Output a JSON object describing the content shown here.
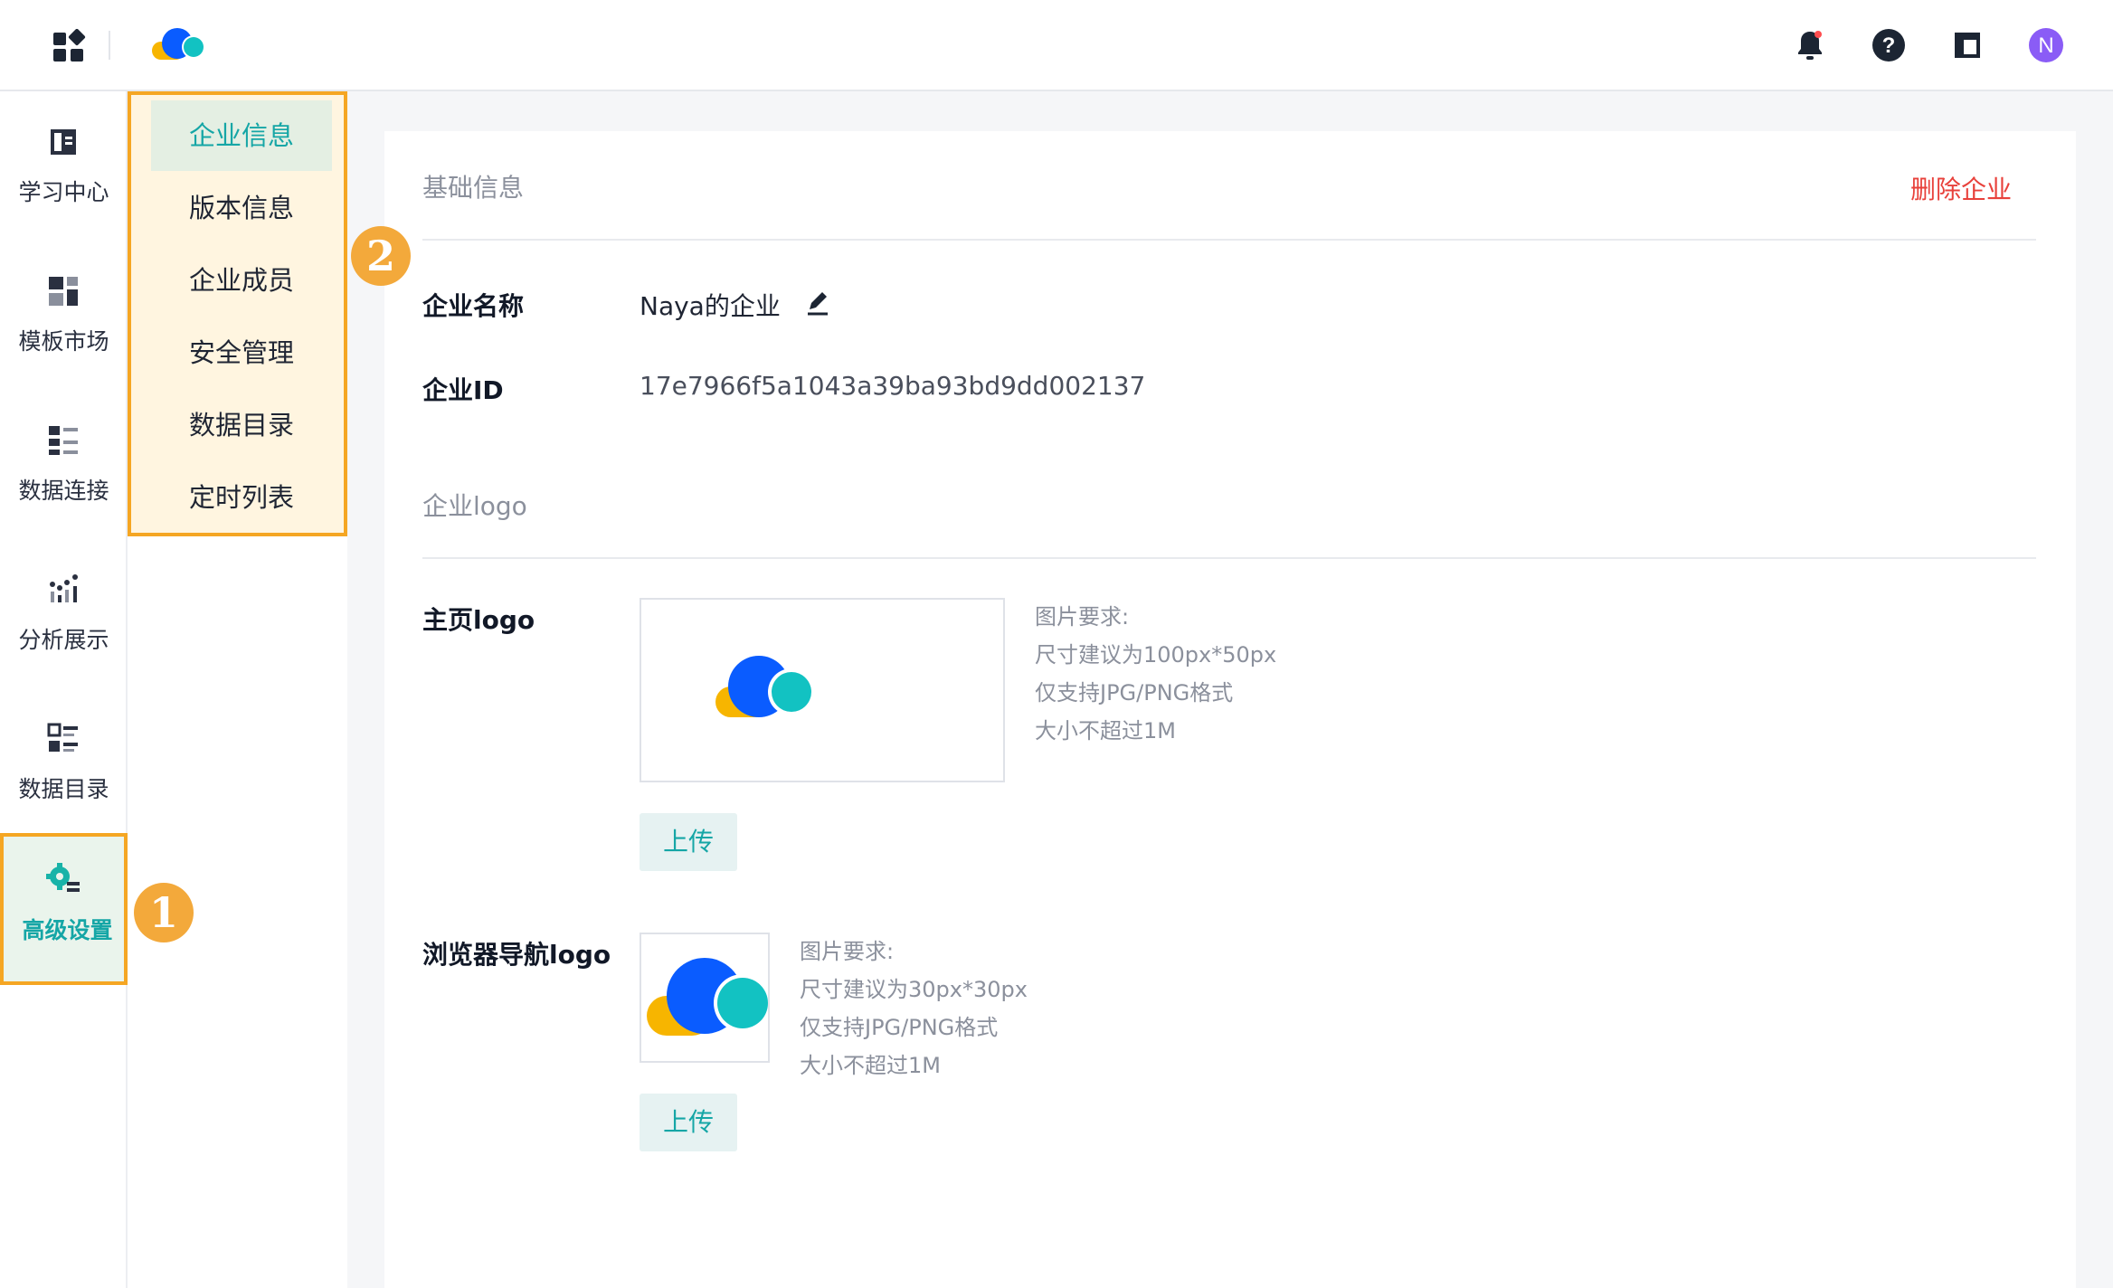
{
  "header": {
    "avatar_letter": "N",
    "accent": "#8a5cf6"
  },
  "rail": {
    "items": [
      {
        "label": "学习中心",
        "icon": "book-icon"
      },
      {
        "label": "模板市场",
        "icon": "template-icon"
      },
      {
        "label": "数据连接",
        "icon": "connection-icon"
      },
      {
        "label": "分析展示",
        "icon": "chart-icon"
      },
      {
        "label": "数据目录",
        "icon": "catalog-icon"
      },
      {
        "label": "高级设置",
        "icon": "settings-icon"
      }
    ],
    "active_index": 5
  },
  "submenu": {
    "items": [
      "企业信息",
      "版本信息",
      "企业成员",
      "安全管理",
      "数据目录",
      "定时列表"
    ],
    "active_index": 0
  },
  "badges": {
    "one": "1",
    "two": "2"
  },
  "main": {
    "basic_section": "基础信息",
    "delete_label": "删除企业",
    "name_label": "企业名称",
    "name_value": "Naya的企业",
    "id_label": "企业ID",
    "id_value": "17e7966f5a1043a39ba93bd9dd002137",
    "logo_section": "企业logo",
    "home_logo": {
      "label": "主页logo",
      "requirements": [
        "图片要求:",
        "尺寸建议为100px*50px",
        "仅支持JPG/PNG格式",
        "大小不超过1M"
      ],
      "upload": "上传"
    },
    "nav_logo": {
      "label": "浏览器导航logo",
      "requirements": [
        "图片要求:",
        "尺寸建议为30px*30px",
        "仅支持JPG/PNG格式",
        "大小不超过1M"
      ],
      "upload": "上传"
    }
  },
  "colors": {
    "accent": "#15a6a6",
    "highlight": "#f5a623",
    "danger": "#e8413b",
    "logo_blue": "#0a5cff",
    "logo_yellow": "#f7b500",
    "logo_teal": "#12c2c2"
  }
}
